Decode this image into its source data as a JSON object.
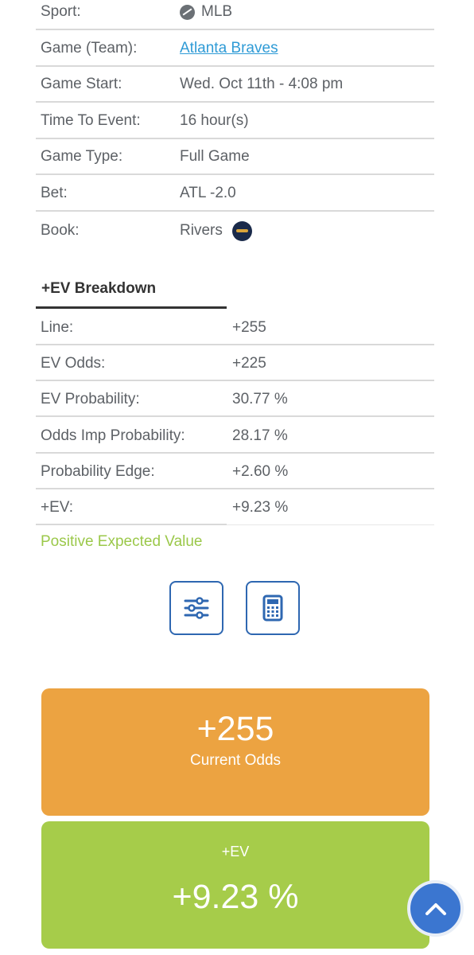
{
  "details": {
    "sport_label": "Sport:",
    "sport_value": "MLB",
    "game_label": "Game (Team):",
    "game_value": "Atlanta Braves",
    "start_label": "Game Start:",
    "start_value": "Wed. Oct 11th - 4:08 pm",
    "time_label": "Time To Event:",
    "time_value": "16 hour(s)",
    "type_label": "Game Type:",
    "type_value": "Full Game",
    "bet_label": "Bet:",
    "bet_value": "ATL -2.0",
    "book_label": "Book:",
    "book_value": "Rivers"
  },
  "breakdown": {
    "title": "+EV Breakdown",
    "rows": [
      {
        "label": "Line:",
        "value": "+255"
      },
      {
        "label": "EV Odds:",
        "value": "+225"
      },
      {
        "label": "EV Probability:",
        "value": "30.77 %"
      },
      {
        "label": "Odds Imp Probability:",
        "value": "28.17 %"
      },
      {
        "label": "Probability Edge:",
        "value": "+2.60 %"
      },
      {
        "label": "+EV:",
        "value": "+9.23 %"
      }
    ],
    "verdict": "Positive Expected Value"
  },
  "cards": {
    "odds_value": "+255",
    "odds_label": "Current Odds",
    "ev_label": "+EV",
    "ev_value": "+9.23 %"
  },
  "colors": {
    "accent_blue": "#2e67b1",
    "orange": "#eca341",
    "green": "#a6cc4a",
    "link": "#2f9bd6"
  },
  "icons": [
    "baseball-icon",
    "rivers-logo-icon",
    "sliders-icon",
    "calculator-icon",
    "chevron-up-icon"
  ]
}
